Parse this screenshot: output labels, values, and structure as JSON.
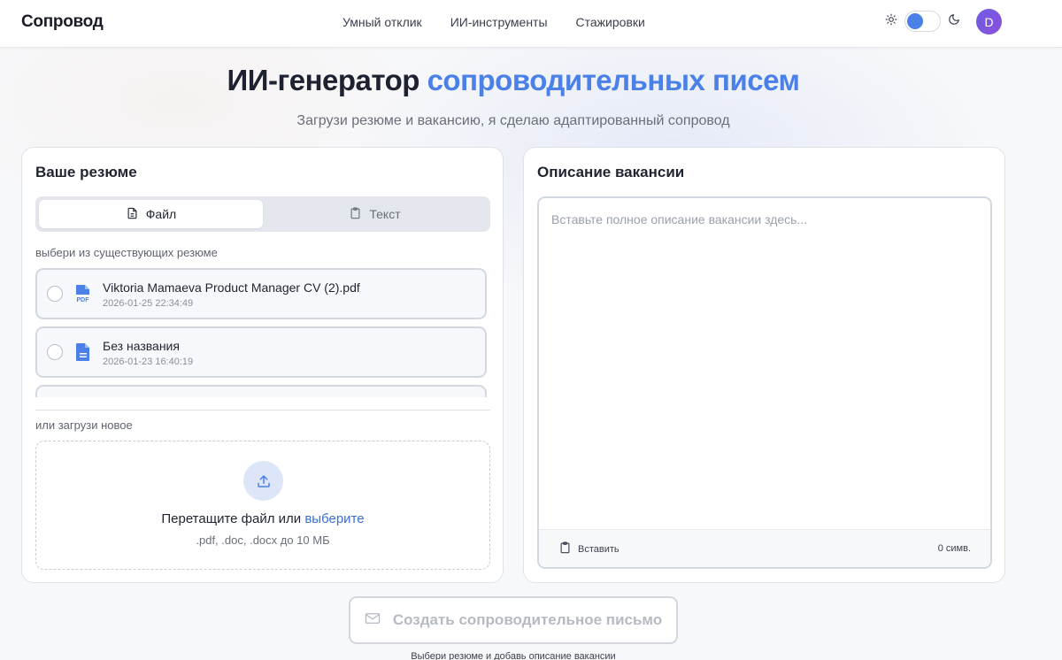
{
  "header": {
    "logo": "Сопровод",
    "nav": [
      "Умный отклик",
      "ИИ-инструменты",
      "Стажировки"
    ],
    "avatar_letter": "D"
  },
  "hero": {
    "title_part1": "ИИ-генератор ",
    "title_accent": "сопроводительных писем",
    "subtitle": "Загрузи резюме и вакансию, я сделаю адаптированный сопровод"
  },
  "resume_card": {
    "title": "Ваше резюме",
    "tabs": {
      "file": "Файл",
      "text": "Текст"
    },
    "existing_label": "выбери из существующих резюме",
    "items": [
      {
        "name": "Viktoria Mamaeva Product Manager CV (2).pdf",
        "date": "2026-01-25 22:34:49",
        "icon": "pdf-file-icon",
        "badge": "PDF"
      },
      {
        "name": "Без названия",
        "date": "2026-01-23 16:40:19",
        "icon": "document-icon"
      }
    ],
    "upload_label": "или загрузи новое",
    "drop_text": "Перетащите файл или ",
    "drop_link": "выберите",
    "drop_hint": ".pdf, .doc, .docx до 10 МБ"
  },
  "vacancy_card": {
    "title": "Описание вакансии",
    "placeholder": "Вставьте полное описание вакансии здесь...",
    "value": "",
    "paste_label": "Вставить",
    "char_count": "0 симв."
  },
  "submit": {
    "label": "Создать сопроводительное письмо",
    "hint": "Выбери резюме и добавь описание вакансии"
  },
  "colors": {
    "accent": "#4a80e8",
    "avatar_gradient_start": "#6f5de6",
    "avatar_gradient_end": "#8a4fd8"
  }
}
